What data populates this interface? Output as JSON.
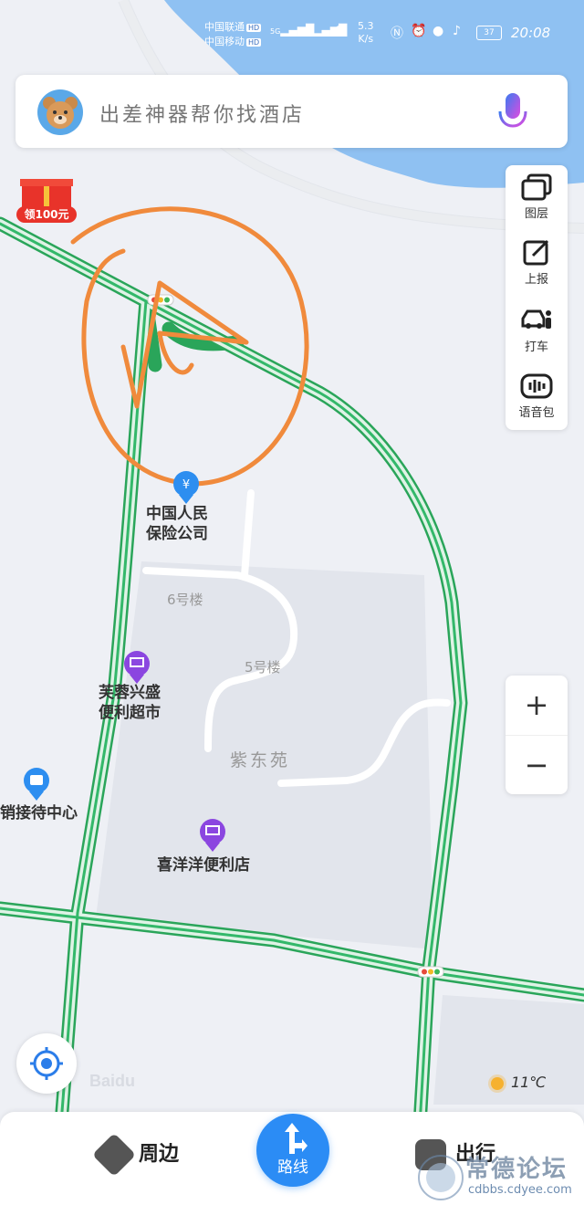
{
  "status_bar": {
    "carrier1": "中国联通",
    "carrier2": "中国移动",
    "hd": "HD",
    "net1": "5G",
    "net2": "4G",
    "speed": "5.3",
    "speed_unit": "K/s",
    "battery": "37",
    "time": "20:08"
  },
  "search": {
    "placeholder": "出差神器帮你找酒店"
  },
  "gift": {
    "label": "领100元"
  },
  "tools": [
    {
      "name": "layers",
      "label": "图层",
      "icon": "layers-icon"
    },
    {
      "name": "report",
      "label": "上报",
      "icon": "edit-icon"
    },
    {
      "name": "taxi",
      "label": "打车",
      "icon": "car-icon"
    },
    {
      "name": "voice",
      "label": "语音包",
      "icon": "voice-pack-icon"
    }
  ],
  "zoom": {
    "in": "+",
    "out": "−"
  },
  "pois": [
    {
      "name": "中国人民保险公司",
      "line1": "中国人民",
      "line2": "保险公司",
      "kind": "bank"
    },
    {
      "name": "芙蓉兴盛便利超市",
      "line1": "芙蓉兴盛",
      "line2": "便利超市",
      "kind": "shop"
    },
    {
      "name": "销接待中心",
      "line1": "销接待中心",
      "kind": "service"
    },
    {
      "name": "喜洋洋便利店",
      "line1": "喜洋洋便利店",
      "kind": "shop"
    }
  ],
  "buildings": {
    "b6": "6号楼",
    "b5": "5号楼",
    "area": "紫东苑"
  },
  "weather": {
    "temp": "11℃"
  },
  "bottom_nav": {
    "nearby": "周边",
    "route": "路线",
    "travel": "出行"
  },
  "watermark": {
    "brand": "常德论坛",
    "url": "cdbbs.cdyee.com"
  },
  "colors": {
    "road_green": "#33b86a",
    "water": "#8fc1f2",
    "accent": "#2b8cf5",
    "annotation": "#f08a3c",
    "poi_purple": "#8b46e0",
    "poi_blue": "#2d8ef0"
  }
}
